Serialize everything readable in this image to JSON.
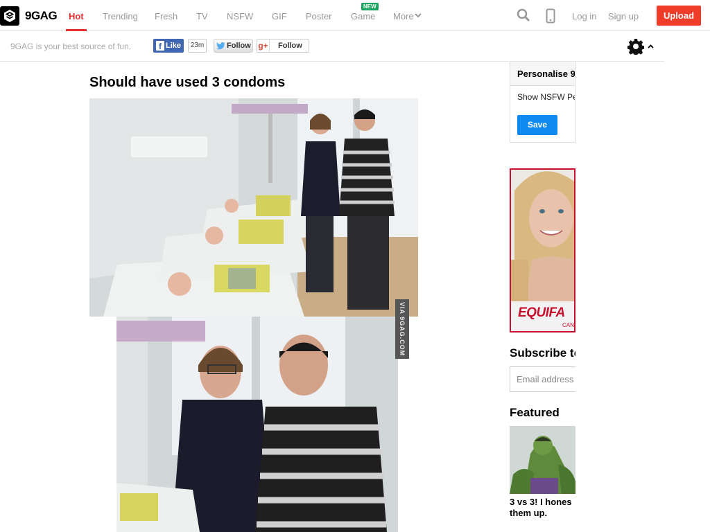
{
  "brand": {
    "name": "9GAG"
  },
  "nav": {
    "items": [
      {
        "label": "Hot"
      },
      {
        "label": "Trending"
      },
      {
        "label": "Fresh"
      },
      {
        "label": "TV"
      },
      {
        "label": "NSFW"
      },
      {
        "label": "GIF"
      },
      {
        "label": "Poster"
      },
      {
        "label": "Game"
      },
      {
        "label": "More"
      }
    ],
    "new_badge": "NEW",
    "login": "Log in",
    "signup": "Sign up",
    "upload": "Upload"
  },
  "subbar": {
    "tagline": "9GAG is your best source of fun.",
    "fb_like": "Like",
    "fb_count": "23m",
    "tw_follow": "Follow",
    "gp_follow": "Follow"
  },
  "post": {
    "title": "Should have used 3 condoms",
    "watermark": "VIA 9GAG.COM"
  },
  "sidebar": {
    "personalise_title": "Personalise 9",
    "show_nsfw": "Show NSFW Pe",
    "save": "Save",
    "ad_brand": "EQUIFA",
    "ad_sub": "CAN",
    "subscribe_title": "Subscribe to",
    "email_placeholder": "Email address",
    "featured_title": "Featured",
    "featured_caption_line1": "3 vs 3! I hones",
    "featured_caption_line2": "them up."
  },
  "colors": {
    "accent": "#e62e2e",
    "upload": "#ef3d29",
    "save": "#0e8af0",
    "facebook": "#4267b2",
    "ad": "#c8102e"
  },
  "icons": [
    "9gag-logo-icon",
    "chevron-down-icon",
    "search-icon",
    "mobile-icon",
    "facebook-icon",
    "twitter-icon",
    "google-plus-icon",
    "gear-icon",
    "caret-up-icon"
  ]
}
